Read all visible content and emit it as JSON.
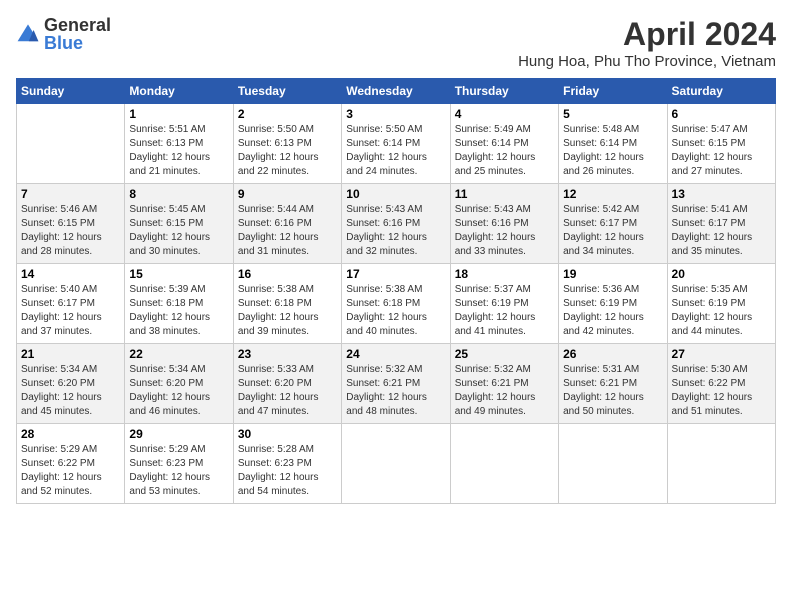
{
  "header": {
    "logo_general": "General",
    "logo_blue": "Blue",
    "month_title": "April 2024",
    "location": "Hung Hoa, Phu Tho Province, Vietnam"
  },
  "days_of_week": [
    "Sunday",
    "Monday",
    "Tuesday",
    "Wednesday",
    "Thursday",
    "Friday",
    "Saturday"
  ],
  "weeks": [
    [
      {
        "day": "",
        "info": ""
      },
      {
        "day": "1",
        "info": "Sunrise: 5:51 AM\nSunset: 6:13 PM\nDaylight: 12 hours\nand 21 minutes."
      },
      {
        "day": "2",
        "info": "Sunrise: 5:50 AM\nSunset: 6:13 PM\nDaylight: 12 hours\nand 22 minutes."
      },
      {
        "day": "3",
        "info": "Sunrise: 5:50 AM\nSunset: 6:14 PM\nDaylight: 12 hours\nand 24 minutes."
      },
      {
        "day": "4",
        "info": "Sunrise: 5:49 AM\nSunset: 6:14 PM\nDaylight: 12 hours\nand 25 minutes."
      },
      {
        "day": "5",
        "info": "Sunrise: 5:48 AM\nSunset: 6:14 PM\nDaylight: 12 hours\nand 26 minutes."
      },
      {
        "day": "6",
        "info": "Sunrise: 5:47 AM\nSunset: 6:15 PM\nDaylight: 12 hours\nand 27 minutes."
      }
    ],
    [
      {
        "day": "7",
        "info": "Sunrise: 5:46 AM\nSunset: 6:15 PM\nDaylight: 12 hours\nand 28 minutes."
      },
      {
        "day": "8",
        "info": "Sunrise: 5:45 AM\nSunset: 6:15 PM\nDaylight: 12 hours\nand 30 minutes."
      },
      {
        "day": "9",
        "info": "Sunrise: 5:44 AM\nSunset: 6:16 PM\nDaylight: 12 hours\nand 31 minutes."
      },
      {
        "day": "10",
        "info": "Sunrise: 5:43 AM\nSunset: 6:16 PM\nDaylight: 12 hours\nand 32 minutes."
      },
      {
        "day": "11",
        "info": "Sunrise: 5:43 AM\nSunset: 6:16 PM\nDaylight: 12 hours\nand 33 minutes."
      },
      {
        "day": "12",
        "info": "Sunrise: 5:42 AM\nSunset: 6:17 PM\nDaylight: 12 hours\nand 34 minutes."
      },
      {
        "day": "13",
        "info": "Sunrise: 5:41 AM\nSunset: 6:17 PM\nDaylight: 12 hours\nand 35 minutes."
      }
    ],
    [
      {
        "day": "14",
        "info": "Sunrise: 5:40 AM\nSunset: 6:17 PM\nDaylight: 12 hours\nand 37 minutes."
      },
      {
        "day": "15",
        "info": "Sunrise: 5:39 AM\nSunset: 6:18 PM\nDaylight: 12 hours\nand 38 minutes."
      },
      {
        "day": "16",
        "info": "Sunrise: 5:38 AM\nSunset: 6:18 PM\nDaylight: 12 hours\nand 39 minutes."
      },
      {
        "day": "17",
        "info": "Sunrise: 5:38 AM\nSunset: 6:18 PM\nDaylight: 12 hours\nand 40 minutes."
      },
      {
        "day": "18",
        "info": "Sunrise: 5:37 AM\nSunset: 6:19 PM\nDaylight: 12 hours\nand 41 minutes."
      },
      {
        "day": "19",
        "info": "Sunrise: 5:36 AM\nSunset: 6:19 PM\nDaylight: 12 hours\nand 42 minutes."
      },
      {
        "day": "20",
        "info": "Sunrise: 5:35 AM\nSunset: 6:19 PM\nDaylight: 12 hours\nand 44 minutes."
      }
    ],
    [
      {
        "day": "21",
        "info": "Sunrise: 5:34 AM\nSunset: 6:20 PM\nDaylight: 12 hours\nand 45 minutes."
      },
      {
        "day": "22",
        "info": "Sunrise: 5:34 AM\nSunset: 6:20 PM\nDaylight: 12 hours\nand 46 minutes."
      },
      {
        "day": "23",
        "info": "Sunrise: 5:33 AM\nSunset: 6:20 PM\nDaylight: 12 hours\nand 47 minutes."
      },
      {
        "day": "24",
        "info": "Sunrise: 5:32 AM\nSunset: 6:21 PM\nDaylight: 12 hours\nand 48 minutes."
      },
      {
        "day": "25",
        "info": "Sunrise: 5:32 AM\nSunset: 6:21 PM\nDaylight: 12 hours\nand 49 minutes."
      },
      {
        "day": "26",
        "info": "Sunrise: 5:31 AM\nSunset: 6:21 PM\nDaylight: 12 hours\nand 50 minutes."
      },
      {
        "day": "27",
        "info": "Sunrise: 5:30 AM\nSunset: 6:22 PM\nDaylight: 12 hours\nand 51 minutes."
      }
    ],
    [
      {
        "day": "28",
        "info": "Sunrise: 5:29 AM\nSunset: 6:22 PM\nDaylight: 12 hours\nand 52 minutes."
      },
      {
        "day": "29",
        "info": "Sunrise: 5:29 AM\nSunset: 6:23 PM\nDaylight: 12 hours\nand 53 minutes."
      },
      {
        "day": "30",
        "info": "Sunrise: 5:28 AM\nSunset: 6:23 PM\nDaylight: 12 hours\nand 54 minutes."
      },
      {
        "day": "",
        "info": ""
      },
      {
        "day": "",
        "info": ""
      },
      {
        "day": "",
        "info": ""
      },
      {
        "day": "",
        "info": ""
      }
    ]
  ]
}
